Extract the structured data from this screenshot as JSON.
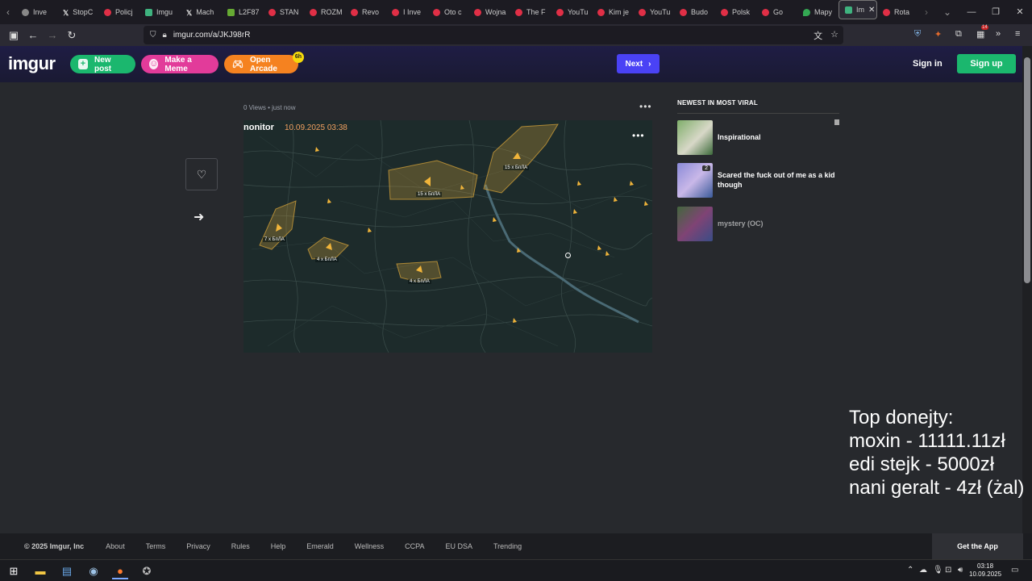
{
  "browser": {
    "tabs": [
      {
        "label": "Inve",
        "icon": "generic"
      },
      {
        "label": "StopC",
        "icon": "x"
      },
      {
        "label": "Policj",
        "icon": "youtube"
      },
      {
        "label": "Imgu",
        "icon": "imgur"
      },
      {
        "label": "Mach",
        "icon": "x"
      },
      {
        "label": "L2F87",
        "icon": "leaf"
      },
      {
        "label": "STAN",
        "icon": "youtube"
      },
      {
        "label": "ROZM",
        "icon": "youtube"
      },
      {
        "label": "Revo",
        "icon": "youtube"
      },
      {
        "label": "I Inve",
        "icon": "youtube"
      },
      {
        "label": "Oto c",
        "icon": "youtube"
      },
      {
        "label": "Wojna",
        "icon": "youtube"
      },
      {
        "label": "The F",
        "icon": "youtube"
      },
      {
        "label": "YouTu",
        "icon": "youtube"
      },
      {
        "label": "Kim je",
        "icon": "youtube"
      },
      {
        "label": "YouTu",
        "icon": "youtube"
      },
      {
        "label": "Budo",
        "icon": "youtube"
      },
      {
        "label": "Polsk",
        "icon": "youtube"
      },
      {
        "label": "Go",
        "icon": "youtube"
      },
      {
        "label": "Mapy",
        "icon": "maps"
      },
      {
        "label": "Im",
        "icon": "imgur",
        "active": true
      },
      {
        "label": "Rota",
        "icon": "youtube"
      }
    ],
    "url": "imgur.com/a/JKJ98rR",
    "extension_badge": "14"
  },
  "header": {
    "logo": "imgur",
    "new_post": "New post",
    "make_meme": "Make a Meme",
    "open_arcade": "Open Arcade",
    "arcade_badge": "6h",
    "next": "Next",
    "sign_in": "Sign in",
    "sign_up": "Sign up"
  },
  "post": {
    "views": "0 Views",
    "time": "just now",
    "media_title": "nonitor",
    "media_timestamp": "10.09.2025 03:38",
    "map_labels": [
      "15 x БпЛА",
      "15 x БпЛА",
      "7 x БпЛА",
      "4 x БпЛА",
      "4 x БпЛА"
    ]
  },
  "sidebar": {
    "title": "NEWEST IN MOST VIRAL",
    "items": [
      {
        "title": "Inspirational",
        "count": ""
      },
      {
        "title": "Scared the fuck out of me as a kid though",
        "count": "2"
      },
      {
        "title": "mystery (OC)",
        "count": ""
      }
    ]
  },
  "overlay": {
    "heading": "Top donejty:",
    "line1": "moxin - 11111.11zł",
    "line2": "edi stejk - 5000zł",
    "line3": "nani geralt - 4zł (żal)"
  },
  "footer": {
    "copyright": "© 2025 Imgur, Inc",
    "links": [
      "About",
      "Terms",
      "Privacy",
      "Rules",
      "Help",
      "Emerald",
      "Wellness",
      "CCPA",
      "EU DSA",
      "Trending"
    ],
    "get_app": "Get the App"
  },
  "taskbar": {
    "time": "03:18",
    "date": "10.09.2025"
  },
  "colors": {
    "brand_green": "#1bb76e",
    "meme_pink": "#e23b9a",
    "arcade_orange": "#f58220",
    "next_blue": "#4a42f5",
    "threat_zone": "#e0a93a"
  }
}
